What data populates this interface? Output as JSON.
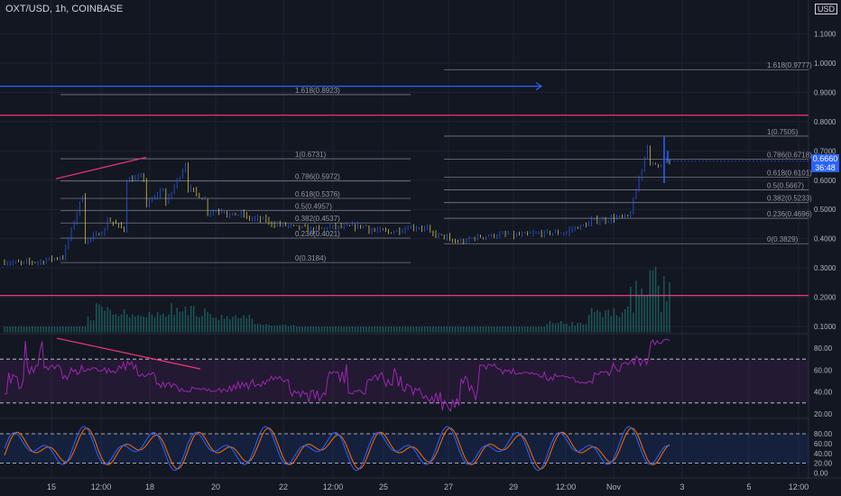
{
  "header": {
    "ticker": "OXT/USD, 1h, COINBASE",
    "currency": "USD"
  },
  "price_badge": {
    "price": "0.6660",
    "countdown": "36:48"
  },
  "colors": {
    "background": "#131722",
    "candle_up": "#2962ff",
    "candle_down": "#e8d44d",
    "resistance": "#f23674",
    "trend_line": "#2962ff",
    "rsi": "#9c27b0",
    "stoch_k": "#2962ff",
    "stoch_d": "#ff6d00",
    "fib": "#787b86"
  },
  "chart_data": [
    {
      "type": "line",
      "name": "price",
      "price_axis": {
        "ticks": [
          "1.1000",
          "1.0000",
          "0.9000",
          "0.8000",
          "0.7000",
          "0.6000",
          "0.5000",
          "0.4000",
          "0.3000",
          "0.2000",
          "0.1000"
        ],
        "range": [
          0.08,
          1.15
        ]
      },
      "time_axis": {
        "ticks": [
          "15",
          "12:00",
          "18",
          "20",
          "22",
          "12:00",
          "25",
          "27",
          "29",
          "12:00",
          "Nov",
          "3",
          "5",
          "12:00"
        ]
      },
      "price_path": [
        [
          0.318,
          0.318
        ],
        [
          0.32,
          0.322
        ],
        [
          0.33,
          0.336
        ],
        [
          0.36,
          0.58
        ],
        [
          0.39,
          0.43
        ],
        [
          0.47,
          0.43
        ],
        [
          0.6,
          0.61
        ],
        [
          0.51,
          0.58
        ],
        [
          0.52,
          0.66
        ],
        [
          0.58,
          0.53
        ],
        [
          0.49,
          0.5
        ],
        [
          0.48,
          0.485
        ],
        [
          0.47,
          0.465
        ],
        [
          0.455,
          0.445
        ],
        [
          0.445,
          0.435
        ],
        [
          0.43,
          0.435
        ],
        [
          0.44,
          0.44
        ],
        [
          0.44,
          0.445
        ],
        [
          0.43,
          0.425
        ],
        [
          0.42,
          0.435
        ],
        [
          0.44,
          0.435
        ],
        [
          0.42,
          0.405
        ],
        [
          0.39,
          0.39
        ],
        [
          0.4,
          0.41
        ],
        [
          0.41,
          0.415
        ],
        [
          0.41,
          0.415
        ],
        [
          0.415,
          0.42
        ],
        [
          0.42,
          0.42
        ],
        [
          0.43,
          0.45
        ],
        [
          0.46,
          0.465
        ],
        [
          0.47,
          0.475
        ],
        [
          0.47,
          0.75
        ],
        [
          0.65,
          0.666
        ]
      ],
      "volume_path": [
        [
          0.1,
          0.1
        ],
        [
          0.1,
          0.1
        ],
        [
          0.12,
          0.18
        ],
        [
          0.13,
          0.15
        ],
        [
          0.13,
          0.18
        ],
        [
          0.12,
          0.14
        ],
        [
          0.1,
          0.11
        ],
        [
          0.1,
          0.1
        ],
        [
          0.1,
          0.1
        ],
        [
          0.1,
          0.1
        ],
        [
          0.1,
          0.1
        ],
        [
          0.1,
          0.1
        ],
        [
          0.1,
          0.1
        ],
        [
          0.1,
          0.12
        ],
        [
          0.13,
          0.17
        ],
        [
          0.14,
          0.32
        ]
      ],
      "horizontal_lines": [
        {
          "label": "",
          "value": 0.822,
          "color": "#f23674"
        },
        {
          "label": "",
          "value": 0.206,
          "color": "#f23674"
        }
      ],
      "fib_left": [
        {
          "label": "1.618(0.8923)",
          "value": 0.8923
        },
        {
          "label": "1(0.6731)",
          "value": 0.6731
        },
        {
          "label": "0.786(0.5972)",
          "value": 0.5972
        },
        {
          "label": "0.618(0.5376)",
          "value": 0.5376
        },
        {
          "label": "0.5(0.4957)",
          "value": 0.4957
        },
        {
          "label": "0.382(0.4537)",
          "value": 0.4537
        },
        {
          "label": "0.236(0.4021)",
          "value": 0.4021
        },
        {
          "label": "0(0.3184)",
          "value": 0.3184
        }
      ],
      "fib_right": [
        {
          "label": "1.618(0.9777)",
          "value": 0.9777
        },
        {
          "label": "1(0.7505)",
          "value": 0.7505
        },
        {
          "label": "0.786(0.6718)",
          "value": 0.6718
        },
        {
          "label": "0.618(0.6101)",
          "value": 0.6101
        },
        {
          "label": "0.5(0.5667)",
          "value": 0.5667
        },
        {
          "label": "0.382(0.5233)",
          "value": 0.5233
        },
        {
          "label": "0.236(0.4696)",
          "value": 0.4696
        },
        {
          "label": "0(0.3829)",
          "value": 0.3829
        }
      ]
    },
    {
      "type": "line",
      "name": "RSI",
      "axis_ticks": [
        "80.00",
        "60.00",
        "40.00",
        "20.00"
      ],
      "range": [
        15,
        95
      ],
      "bands": [
        70,
        30
      ],
      "path": [
        [
          38,
          62
        ],
        [
          45,
          88
        ],
        [
          65,
          60
        ],
        [
          50,
          62
        ],
        [
          58,
          65
        ],
        [
          56,
          62
        ],
        [
          60,
          68
        ],
        [
          58,
          54
        ],
        [
          50,
          44
        ],
        [
          45,
          40
        ],
        [
          40,
          44
        ],
        [
          38,
          46
        ],
        [
          42,
          50
        ],
        [
          45,
          52
        ],
        [
          48,
          55
        ],
        [
          35,
          44
        ],
        [
          30,
          42
        ],
        [
          45,
          70
        ],
        [
          38,
          42
        ],
        [
          50,
          60
        ],
        [
          40,
          62
        ],
        [
          35,
          48
        ],
        [
          28,
          40
        ],
        [
          22,
          35
        ],
        [
          30,
          55
        ],
        [
          60,
          66
        ],
        [
          62,
          56
        ],
        [
          58,
          55
        ],
        [
          50,
          60
        ],
        [
          55,
          52
        ],
        [
          50,
          48
        ],
        [
          55,
          62
        ],
        [
          58,
          68
        ],
        [
          60,
          78
        ],
        [
          88,
          82
        ]
      ],
      "trend_line": [
        [
          63,
          89
        ],
        [
          222,
          61
        ]
      ]
    },
    {
      "type": "line",
      "name": "Stoch",
      "axis_ticks": [
        "80.00",
        "60.00",
        "40.00",
        "20.00",
        "0.00"
      ],
      "range": [
        -5,
        105
      ],
      "bands": [
        80,
        20
      ]
    }
  ]
}
